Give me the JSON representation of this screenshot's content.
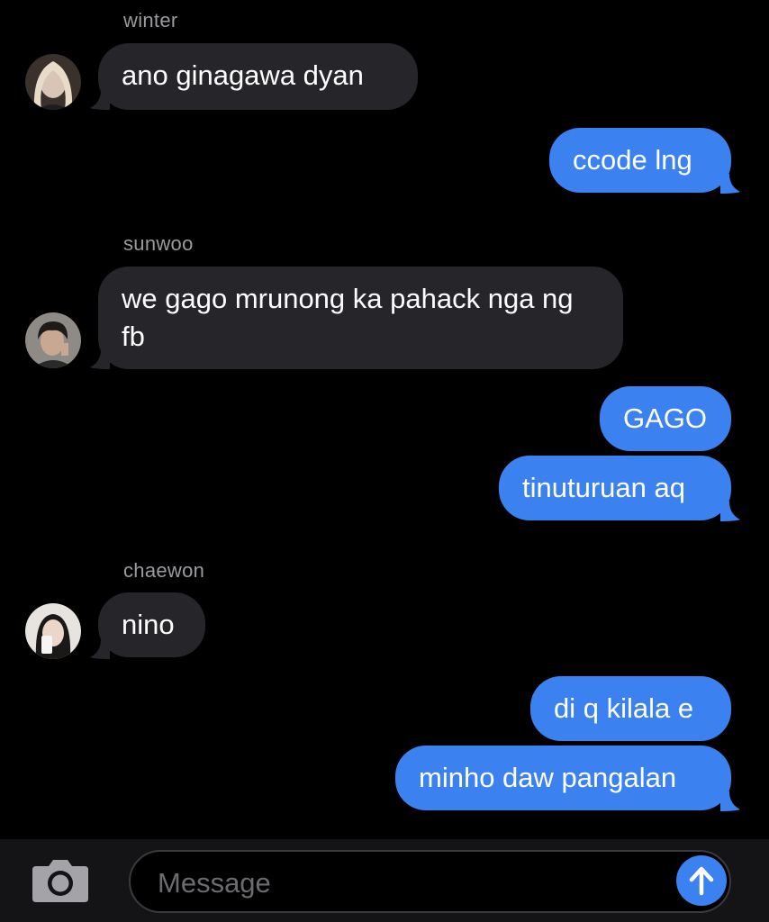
{
  "thread": {
    "group1": {
      "sender": "winter",
      "messages": [
        "ano ginagawa dyan"
      ]
    },
    "reply1": [
      "ccode lng"
    ],
    "group2": {
      "sender": "sunwoo",
      "messages": [
        "we gago mrunong ka pahack nga ng fb"
      ]
    },
    "reply2": [
      "GAGO",
      "tinuturuan aq"
    ],
    "group3": {
      "sender": "chaewon",
      "messages": [
        "nino"
      ]
    },
    "reply3": [
      "di q kilala e",
      "minho daw pangalan"
    ]
  },
  "composer": {
    "placeholder": "Message",
    "camera_icon": "camera-icon",
    "send_icon": "arrow-up-icon"
  },
  "colors": {
    "outgoing": "#3b82f0",
    "incoming": "#26252a",
    "background": "#000000"
  }
}
